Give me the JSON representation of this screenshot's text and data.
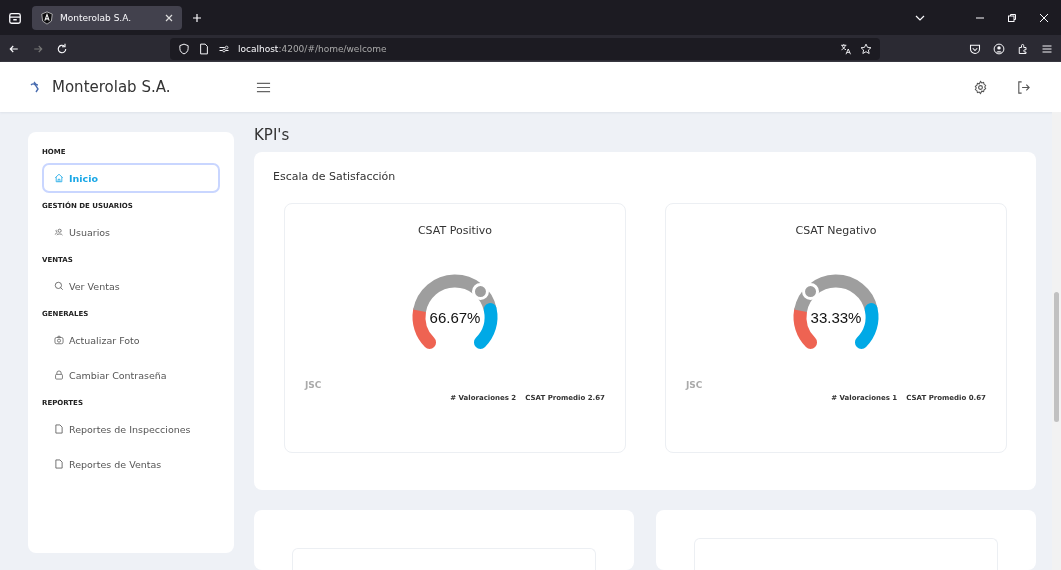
{
  "browser": {
    "tab_title": "Monterolab S.A.",
    "url_host": "localhost",
    "url_rest": ":4200/#/home/welcome"
  },
  "header": {
    "brand": "Monterolab S.A."
  },
  "sidebar": {
    "sections": [
      {
        "title": "HOME",
        "items": [
          {
            "label": "Inicio",
            "kind": "home",
            "selected": true
          }
        ]
      },
      {
        "title": "GESTIÓN DE USUARIOS",
        "items": [
          {
            "label": "Usuarios",
            "kind": "users",
            "selected": false
          }
        ]
      },
      {
        "title": "VENTAS",
        "items": [
          {
            "label": "Ver Ventas",
            "kind": "search",
            "selected": false
          }
        ]
      },
      {
        "title": "GENERALES",
        "items": [
          {
            "label": "Actualizar Foto",
            "kind": "camera",
            "selected": false
          },
          {
            "label": "Cambiar Contraseña",
            "kind": "lock",
            "selected": false
          }
        ]
      },
      {
        "title": "REPORTES",
        "items": [
          {
            "label": "Reportes de Inspecciones",
            "kind": "file",
            "selected": false
          },
          {
            "label": "Reportes de Ventas",
            "kind": "file",
            "selected": false
          }
        ]
      }
    ]
  },
  "page_title": "KPI's",
  "panel": {
    "title": "Escala de Satisfacción",
    "gauges": [
      {
        "title": "CSAT Positivo",
        "reading": "66.67%",
        "logo": "JSC",
        "count": "# Valoraciones 2",
        "average": "CSAT Promedio 2.67"
      },
      {
        "title": "CSAT Negativo",
        "reading": "33.33%",
        "logo": "JSC",
        "count": "# Valoraciones 1",
        "average": "CSAT Promedio 0.67"
      }
    ]
  }
}
